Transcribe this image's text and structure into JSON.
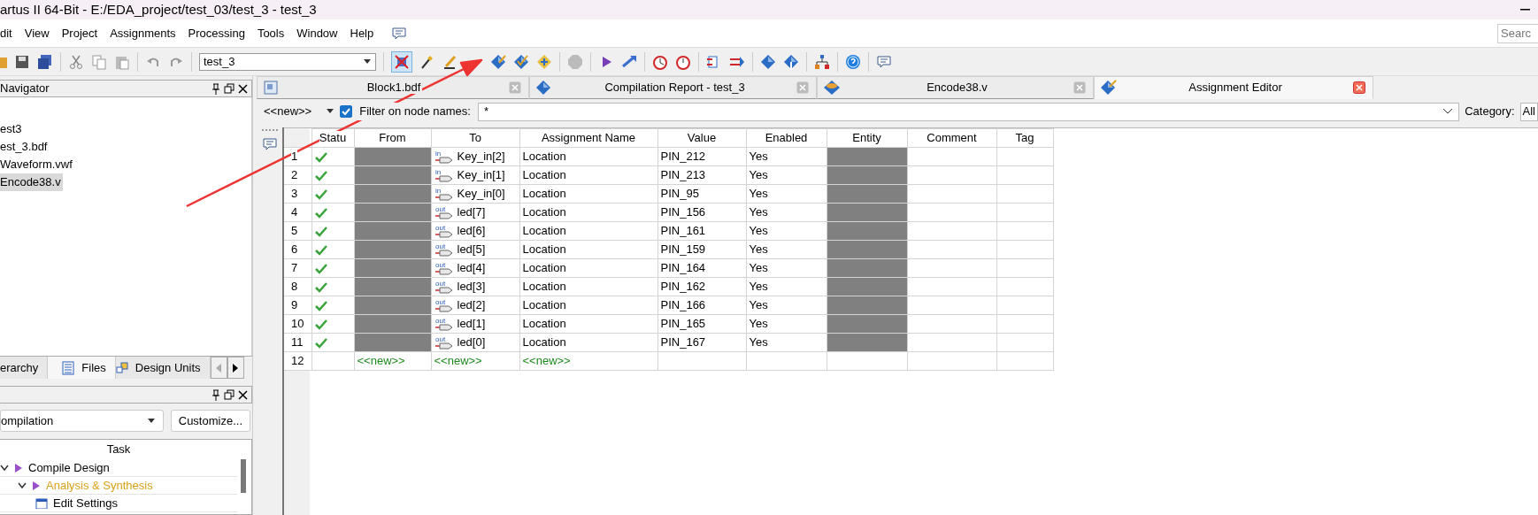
{
  "window": {
    "title": "artus II 64-Bit - E:/EDA_project/test_03/test_3 - test_3"
  },
  "menu": [
    "dit",
    "View",
    "Project",
    "Assignments",
    "Processing",
    "Tools",
    "Window",
    "Help"
  ],
  "search": {
    "placeholder": "Searc"
  },
  "toolbar": {
    "project": "test_3"
  },
  "navigator": {
    "title": "Navigator",
    "items": [
      {
        "label": "est3",
        "selected": false
      },
      {
        "label": "est_3.bdf",
        "selected": false
      },
      {
        "label": "Waveform.vwf",
        "selected": false
      },
      {
        "label": "Encode38.v",
        "selected": true
      }
    ],
    "tabs": [
      {
        "label": "erarchy",
        "selected": false
      },
      {
        "label": "Files",
        "selected": true
      },
      {
        "label": "Design Units",
        "selected": false
      }
    ]
  },
  "tasks": {
    "flow": "ompilation",
    "customize": "Customize...",
    "header": "Task",
    "items": [
      {
        "label": "Compile Design",
        "current": false,
        "children": [
          {
            "label": "Analysis & Synthesis",
            "current": true,
            "children": [
              {
                "label": "Edit Settings",
                "current": false
              }
            ]
          }
        ]
      }
    ]
  },
  "tabs": [
    {
      "label": "Block1.bdf",
      "selected": false
    },
    {
      "label": "Compilation Report - test_3",
      "selected": false
    },
    {
      "label": "Encode38.v",
      "selected": false
    },
    {
      "label": "Assignment Editor",
      "selected": true
    }
  ],
  "filter": {
    "preset": "<<new>>",
    "checked": true,
    "label": "Filter on node names:",
    "value": "*",
    "category_label": "Category:",
    "category": "All"
  },
  "table": {
    "columns": [
      "Statu",
      "From",
      "To",
      "Assignment Name",
      "Value",
      "Enabled",
      "Entity",
      "Comment",
      "Tag"
    ],
    "rows": [
      {
        "number": "1",
        "ok": true,
        "redacted": true,
        "direction": "in",
        "to": "Key_in[2]",
        "assignment": "Location",
        "value": "PIN_212",
        "enabled": "Yes"
      },
      {
        "number": "2",
        "ok": true,
        "redacted": true,
        "direction": "in",
        "to": "Key_in[1]",
        "assignment": "Location",
        "value": "PIN_213",
        "enabled": "Yes"
      },
      {
        "number": "3",
        "ok": true,
        "redacted": true,
        "direction": "in",
        "to": "Key_in[0]",
        "assignment": "Location",
        "value": "PIN_95",
        "enabled": "Yes"
      },
      {
        "number": "4",
        "ok": true,
        "redacted": true,
        "direction": "out",
        "to": "led[7]",
        "assignment": "Location",
        "value": "PIN_156",
        "enabled": "Yes"
      },
      {
        "number": "5",
        "ok": true,
        "redacted": true,
        "direction": "out",
        "to": "led[6]",
        "assignment": "Location",
        "value": "PIN_161",
        "enabled": "Yes"
      },
      {
        "number": "6",
        "ok": true,
        "redacted": true,
        "direction": "out",
        "to": "led[5]",
        "assignment": "Location",
        "value": "PIN_159",
        "enabled": "Yes"
      },
      {
        "number": "7",
        "ok": true,
        "redacted": true,
        "direction": "out",
        "to": "led[4]",
        "assignment": "Location",
        "value": "PIN_164",
        "enabled": "Yes"
      },
      {
        "number": "8",
        "ok": true,
        "redacted": true,
        "direction": "out",
        "to": "led[3]",
        "assignment": "Location",
        "value": "PIN_162",
        "enabled": "Yes"
      },
      {
        "number": "9",
        "ok": true,
        "redacted": true,
        "direction": "out",
        "to": "led[2]",
        "assignment": "Location",
        "value": "PIN_166",
        "enabled": "Yes"
      },
      {
        "number": "10",
        "ok": true,
        "redacted": true,
        "direction": "out",
        "to": "led[1]",
        "assignment": "Location",
        "value": "PIN_165",
        "enabled": "Yes"
      },
      {
        "number": "11",
        "ok": true,
        "redacted": true,
        "direction": "out",
        "to": "led[0]",
        "assignment": "Location",
        "value": "PIN_167",
        "enabled": "Yes"
      },
      {
        "number": "12",
        "ok": false,
        "redacted": false,
        "from": "<<new>>",
        "to": "<<new>>",
        "assignment": "<<new>>"
      }
    ]
  }
}
